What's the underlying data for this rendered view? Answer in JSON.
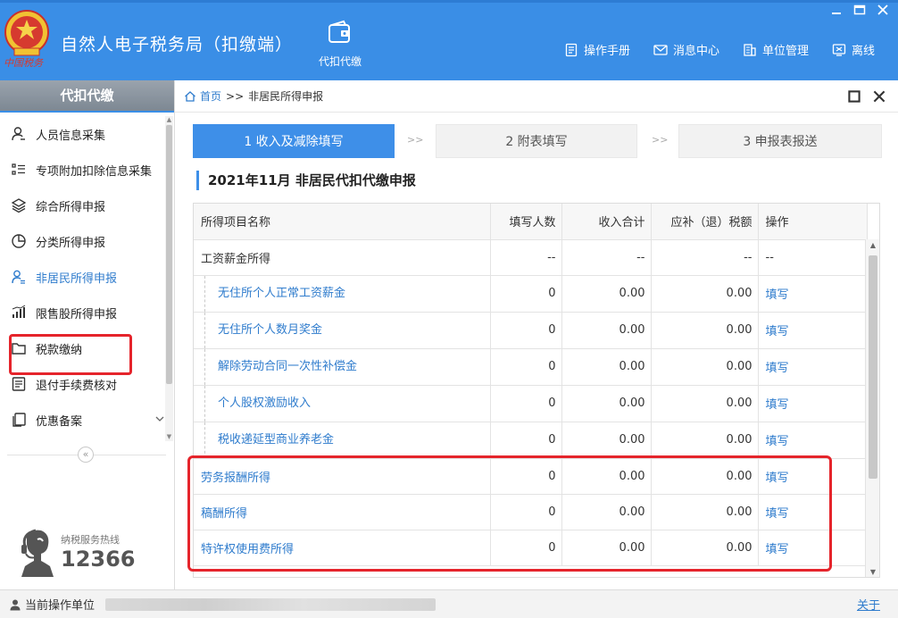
{
  "app": {
    "title": "自然人电子税务局（扣缴端）",
    "emblem_text": "中国税务",
    "module_label": "代扣代缴"
  },
  "top_links": [
    {
      "label": "操作手册",
      "icon": "manual-icon"
    },
    {
      "label": "消息中心",
      "icon": "mail-icon"
    },
    {
      "label": "单位管理",
      "icon": "building-icon"
    },
    {
      "label": "离线",
      "icon": "offline-icon"
    }
  ],
  "sidebar": {
    "heading": "代扣代缴",
    "items": [
      {
        "label": "人员信息采集",
        "icon": "person-icon"
      },
      {
        "label": "专项附加扣除信息采集",
        "icon": "list-icon"
      },
      {
        "label": "综合所得申报",
        "icon": "layers-icon"
      },
      {
        "label": "分类所得申报",
        "icon": "pie-icon"
      },
      {
        "label": "非居民所得申报",
        "icon": "person-doc-icon"
      },
      {
        "label": "限售股所得申报",
        "icon": "bar-chart-icon"
      },
      {
        "label": "税款缴纳",
        "icon": "folder-icon"
      },
      {
        "label": "退付手续费核对",
        "icon": "checklist-icon"
      },
      {
        "label": "优惠备案",
        "icon": "copy-icon"
      }
    ],
    "hotline_label": "纳税服务热线",
    "hotline_number": "12366"
  },
  "breadcrumb": {
    "home": "首页",
    "sep": ">>",
    "current": "非居民所得申报"
  },
  "steps": [
    {
      "label": "1 收入及减除填写"
    },
    {
      "label": "2 附表填写"
    },
    {
      "label": "3 申报表报送"
    }
  ],
  "step_arrow": ">>",
  "section_title": "2021年11月  非居民代扣代缴申报",
  "table": {
    "headers": [
      "所得项目名称",
      "填写人数",
      "收入合计",
      "应补（退）税额",
      "操作"
    ],
    "rows": [
      {
        "name": "工资薪金所得",
        "count": "--",
        "income": "--",
        "tax": "--",
        "op": "--"
      },
      {
        "name": "无住所个人正常工资薪金",
        "count": "0",
        "income": "0.00",
        "tax": "0.00",
        "op": "填写"
      },
      {
        "name": "无住所个人数月奖金",
        "count": "0",
        "income": "0.00",
        "tax": "0.00",
        "op": "填写"
      },
      {
        "name": "解除劳动合同一次性补偿金",
        "count": "0",
        "income": "0.00",
        "tax": "0.00",
        "op": "填写"
      },
      {
        "name": "个人股权激励收入",
        "count": "0",
        "income": "0.00",
        "tax": "0.00",
        "op": "填写"
      },
      {
        "name": "税收递延型商业养老金",
        "count": "0",
        "income": "0.00",
        "tax": "0.00",
        "op": "填写"
      },
      {
        "name": "劳务报酬所得",
        "count": "0",
        "income": "0.00",
        "tax": "0.00",
        "op": "填写"
      },
      {
        "name": "稿酬所得",
        "count": "0",
        "income": "0.00",
        "tax": "0.00",
        "op": "填写"
      },
      {
        "name": "特许权使用费所得",
        "count": "0",
        "income": "0.00",
        "tax": "0.00",
        "op": "填写"
      }
    ]
  },
  "status": {
    "label": "当前操作单位",
    "about": "关于"
  },
  "colors": {
    "header": "#3a8ee6",
    "link": "#2f7ccd",
    "highlight": "#e5242b"
  }
}
